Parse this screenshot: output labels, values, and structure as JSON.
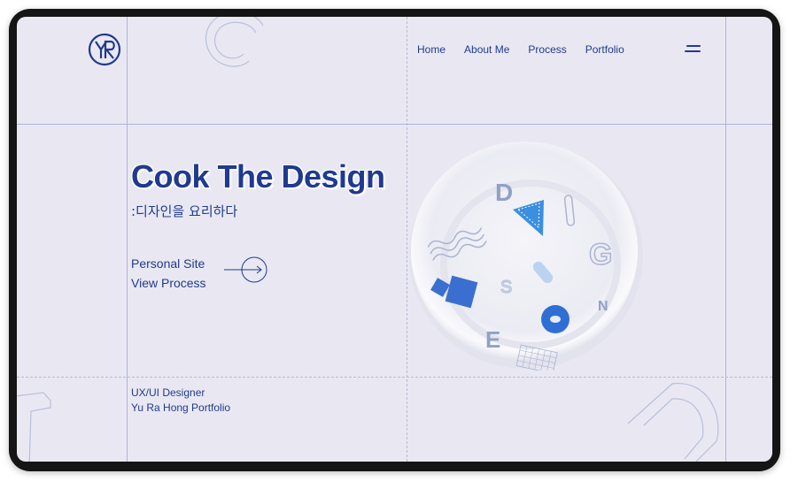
{
  "logo": {
    "text": "YR"
  },
  "nav": {
    "items": [
      {
        "label": "Home"
      },
      {
        "label": "About Me"
      },
      {
        "label": "Process"
      },
      {
        "label": "Portfolio"
      }
    ]
  },
  "hero": {
    "title": "Cook The Design",
    "subtitle": ":디자인을 요리하다",
    "links": [
      {
        "label": "Personal Site"
      },
      {
        "label": "View Process"
      }
    ]
  },
  "footer": {
    "role": "UX/UI Designer",
    "name": "Yu Ra Hong Portfolio"
  },
  "bowl_letters": {
    "d": "D",
    "i": "I",
    "g": "G",
    "s": "S",
    "n": "N",
    "e": "E"
  },
  "colors": {
    "accent": "#1f3a8f",
    "background": "#e9e8f2",
    "grid": "#aeb3d8",
    "shape_blue": "#3a6fd0",
    "letter_gray": "#8fa1c7"
  },
  "icons": {
    "logo": "yr-monogram-icon",
    "menu": "hamburger-menu-icon",
    "arrow": "arrow-right-circle-icon"
  }
}
